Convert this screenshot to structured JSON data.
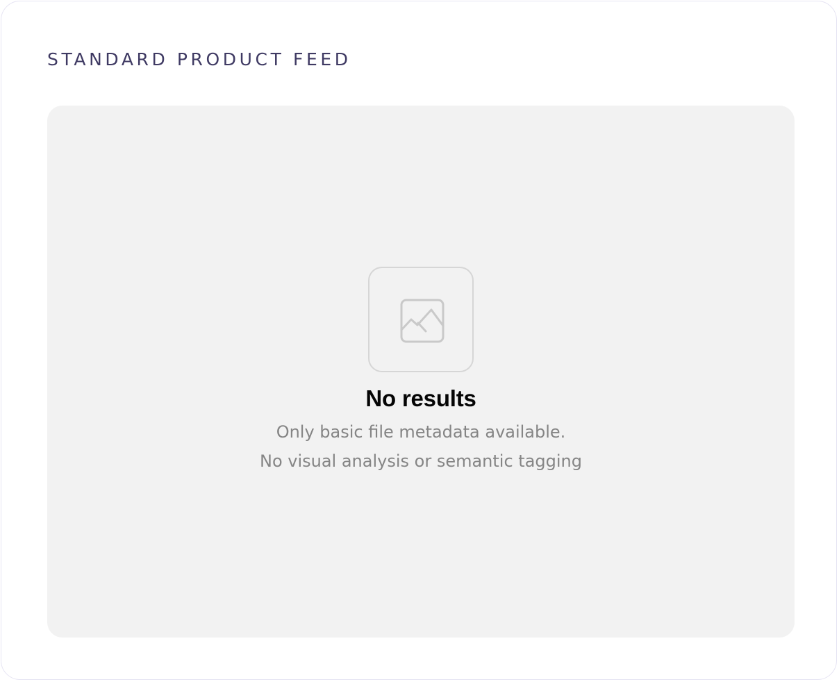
{
  "section": {
    "title": "STANDARD PRODUCT FEED"
  },
  "empty_state": {
    "icon": "image-placeholder-icon",
    "title": "No results",
    "lines": [
      "Only basic file metadata available.",
      "No visual analysis or semantic tagging"
    ]
  },
  "colors": {
    "title": "#3f3a63",
    "panel_background": "#f2f2f2",
    "card_border": "#e6e4f3",
    "empty_title": "#050505",
    "empty_text": "#858585",
    "icon_stroke": "#c9c9c9"
  }
}
